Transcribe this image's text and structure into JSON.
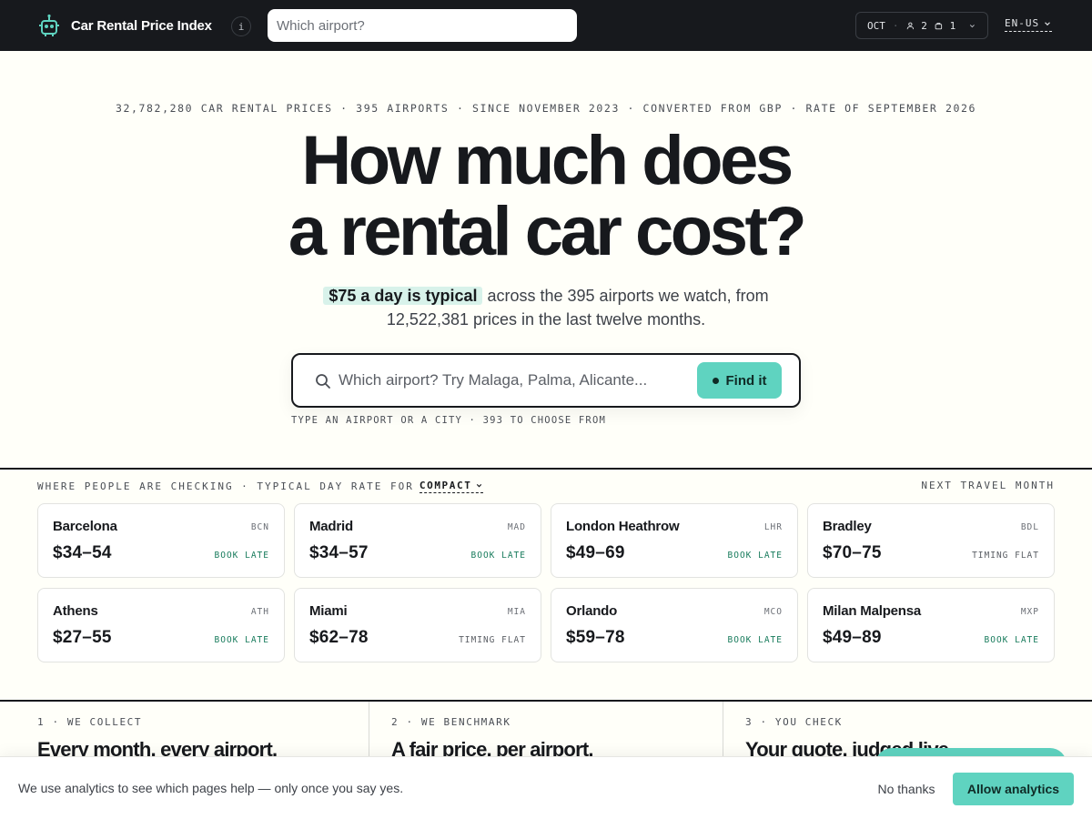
{
  "header": {
    "brand_name": "Car Rental Price Index",
    "info_label": "i",
    "search_placeholder": "Which airport?",
    "trip": {
      "month": "OCT",
      "separator": "·",
      "travelers": "2",
      "bags": "1"
    },
    "language": "EN-US"
  },
  "hero": {
    "stats_line": "32,782,280 CAR RENTAL PRICES · 395 AIRPORTS · SINCE NOVEMBER 2023 · CONVERTED FROM GBP · RATE OF SEPTEMBER 2026",
    "title_line1": "How much does",
    "title_line2": "a rental car cost?",
    "sub_highlight": "$75 a day is typical",
    "sub_rest_1": " across the 395 airports we watch, from",
    "sub_rest_2": "12,522,381 prices in the last twelve months.",
    "search_placeholder": "Which airport? Try Malaga, Palma, Alicante...",
    "find_label": "Find it",
    "hint": "TYPE AN AIRPORT OR A CITY · 393 TO CHOOSE FROM"
  },
  "airports": {
    "left_label": "WHERE PEOPLE ARE CHECKING · TYPICAL DAY RATE FOR",
    "class_label": "COMPACT",
    "right_label": "NEXT TRAVEL MONTH",
    "cards": [
      {
        "name": "Barcelona",
        "code": "BCN",
        "price": "$34–54",
        "tag": "BOOK LATE",
        "tag_kind": "late"
      },
      {
        "name": "Madrid",
        "code": "MAD",
        "price": "$34–57",
        "tag": "BOOK LATE",
        "tag_kind": "late"
      },
      {
        "name": "London Heathrow",
        "code": "LHR",
        "price": "$49–69",
        "tag": "BOOK LATE",
        "tag_kind": "late"
      },
      {
        "name": "Bradley",
        "code": "BDL",
        "price": "$70–75",
        "tag": "TIMING FLAT",
        "tag_kind": "flat"
      },
      {
        "name": "Athens",
        "code": "ATH",
        "price": "$27–55",
        "tag": "BOOK LATE",
        "tag_kind": "late"
      },
      {
        "name": "Miami",
        "code": "MIA",
        "price": "$62–78",
        "tag": "TIMING FLAT",
        "tag_kind": "flat"
      },
      {
        "name": "Orlando",
        "code": "MCO",
        "price": "$59–78",
        "tag": "BOOK LATE",
        "tag_kind": "late"
      },
      {
        "name": "Milan Malpensa",
        "code": "MXP",
        "price": "$49–89",
        "tag": "BOOK LATE",
        "tag_kind": "late"
      }
    ]
  },
  "how": {
    "steps": [
      {
        "step": "1 · WE COLLECT",
        "title": "Every month, every airport."
      },
      {
        "step": "2 · WE BENCHMARK",
        "title": "A fair price, per airport."
      },
      {
        "step": "3 · YOU CHECK",
        "title": "Your quote, judged live."
      }
    ]
  },
  "cookie": {
    "text": "We use analytics to see which pages help — only once you say yes.",
    "decline_label": "No thanks",
    "accept_label": "Allow analytics"
  },
  "colors": {
    "accent": "#5fd3c0",
    "dark": "#17191d",
    "highlight": "#d8f2ea",
    "tag_late": "#167a5b"
  }
}
